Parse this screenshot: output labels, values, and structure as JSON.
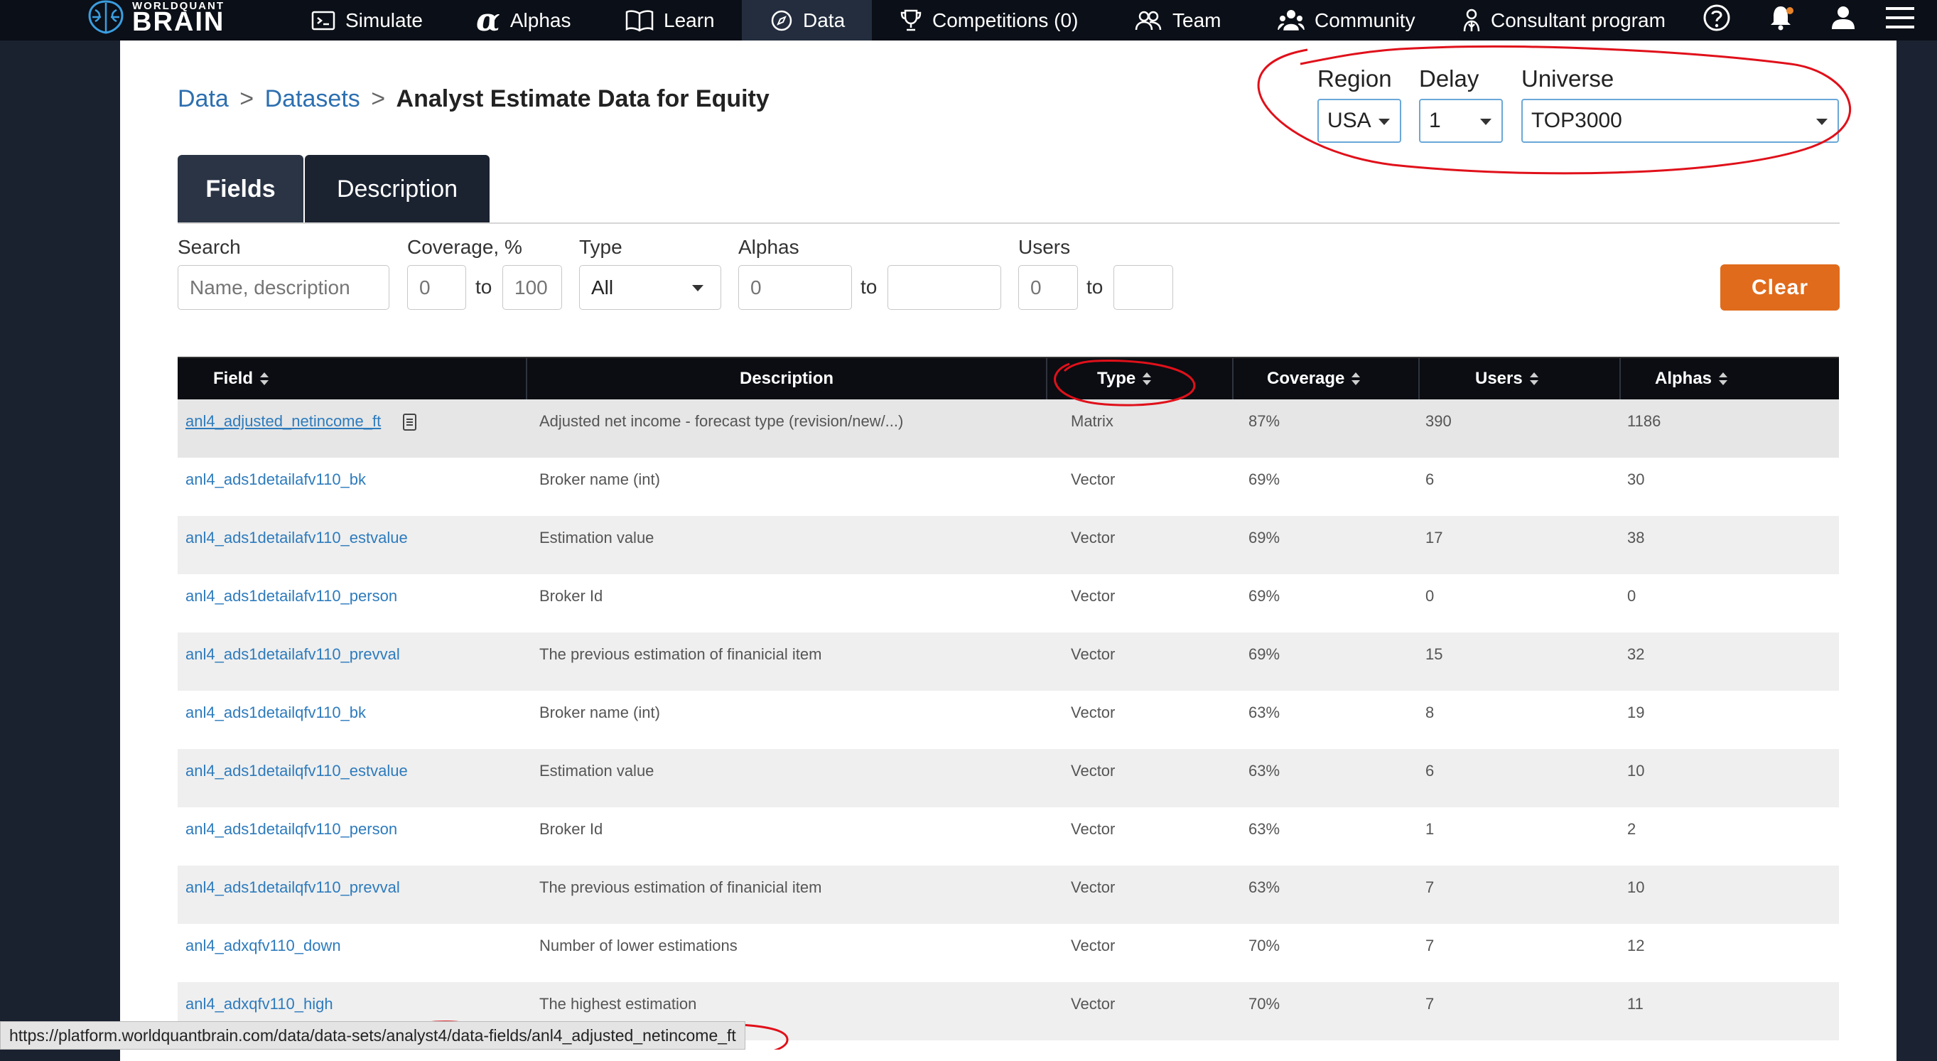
{
  "nav": {
    "logo_small": "WORLDQUANT",
    "logo_big": "BRAIN",
    "items": [
      {
        "label": "Simulate",
        "icon": "terminal-icon"
      },
      {
        "label": "Alphas",
        "icon": "alpha-icon"
      },
      {
        "label": "Learn",
        "icon": "book-icon"
      },
      {
        "label": "Data",
        "icon": "compass-icon",
        "active": true
      },
      {
        "label": "Competitions (0)",
        "icon": "trophy-icon"
      },
      {
        "label": "Team",
        "icon": "team-icon"
      },
      {
        "label": "Community",
        "icon": "community-icon"
      },
      {
        "label": "Consultant program",
        "icon": "consultant-icon"
      }
    ],
    "right_icons": [
      "help-icon",
      "notification-bell-icon",
      "user-icon",
      "menu-icon"
    ]
  },
  "breadcrumb": {
    "data": "Data",
    "datasets": "Datasets",
    "separator": ">",
    "current": "Analyst Estimate Data for Equity"
  },
  "selectors": {
    "region_label": "Region",
    "region_value": "USA",
    "delay_label": "Delay",
    "delay_value": "1",
    "universe_label": "Universe",
    "universe_value": "TOP3000"
  },
  "tabs": {
    "fields": "Fields",
    "description": "Description"
  },
  "filters": {
    "search_label": "Search",
    "search_placeholder": "Name, description",
    "coverage_label": "Coverage, %",
    "coverage_min_placeholder": "0",
    "coverage_max_placeholder": "100",
    "type_label": "Type",
    "type_value": "All",
    "alphas_label": "Alphas",
    "alphas_min_placeholder": "0",
    "users_label": "Users",
    "users_min_placeholder": "0",
    "to": "to",
    "clear": "Clear"
  },
  "table": {
    "headers": {
      "field": "Field",
      "description": "Description",
      "type": "Type",
      "coverage": "Coverage",
      "users": "Users",
      "alphas": "Alphas"
    },
    "rows": [
      {
        "field": "anl4_adjusted_netincome_ft",
        "description": "Adjusted net income - forecast type (revision/new/...)",
        "type": "Matrix",
        "coverage": "87%",
        "users": "390",
        "alphas": "1186"
      },
      {
        "field": "anl4_ads1detailafv110_bk",
        "description": "Broker name (int)",
        "type": "Vector",
        "coverage": "69%",
        "users": "6",
        "alphas": "30"
      },
      {
        "field": "anl4_ads1detailafv110_estvalue",
        "description": "Estimation value",
        "type": "Vector",
        "coverage": "69%",
        "users": "17",
        "alphas": "38"
      },
      {
        "field": "anl4_ads1detailafv110_person",
        "description": "Broker Id",
        "type": "Vector",
        "coverage": "69%",
        "users": "0",
        "alphas": "0"
      },
      {
        "field": "anl4_ads1detailafv110_prevval",
        "description": "The previous estimation of finanicial item",
        "type": "Vector",
        "coverage": "69%",
        "users": "15",
        "alphas": "32"
      },
      {
        "field": "anl4_ads1detailqfv110_bk",
        "description": "Broker name (int)",
        "type": "Vector",
        "coverage": "63%",
        "users": "8",
        "alphas": "19"
      },
      {
        "field": "anl4_ads1detailqfv110_estvalue",
        "description": "Estimation value",
        "type": "Vector",
        "coverage": "63%",
        "users": "6",
        "alphas": "10"
      },
      {
        "field": "anl4_ads1detailqfv110_person",
        "description": "Broker Id",
        "type": "Vector",
        "coverage": "63%",
        "users": "1",
        "alphas": "2"
      },
      {
        "field": "anl4_ads1detailqfv110_prevval",
        "description": "The previous estimation of finanicial item",
        "type": "Vector",
        "coverage": "63%",
        "users": "7",
        "alphas": "10"
      },
      {
        "field": "anl4_adxqfv110_down",
        "description": "Number of lower estimations",
        "type": "Vector",
        "coverage": "70%",
        "users": "7",
        "alphas": "12"
      },
      {
        "field": "anl4_adxqfv110_high",
        "description": "The highest estimation",
        "type": "Vector",
        "coverage": "70%",
        "users": "7",
        "alphas": "11"
      }
    ]
  },
  "status_url": "https://platform.worldquantbrain.com/data/data-sets/analyst4/data-fields/anl4_adjusted_netincome_ft",
  "colors": {
    "nav_bg": "#0b0f17",
    "link": "#2d7bbd",
    "accent_orange": "#e06b1c",
    "annotation_red": "#e0101a"
  }
}
